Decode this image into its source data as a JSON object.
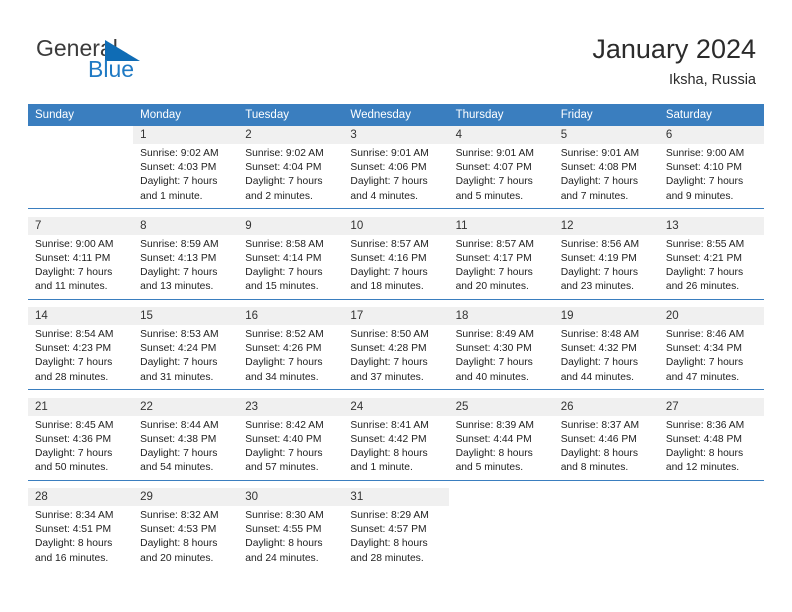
{
  "brand": {
    "name_top": "General",
    "name_bottom": "Blue",
    "logo_icon": "triangle-flag-icon",
    "color_top": "#3b3b3b",
    "color_bottom": "#1f7ac4",
    "triangle_color": "#0f6cb5"
  },
  "header": {
    "title": "January 2024",
    "subtitle": "Iksha, Russia"
  },
  "theme": {
    "header_bg": "#3a7ebf",
    "header_text": "#ffffff",
    "daynum_bg": "#f0f0f0",
    "week_rule": "#3a7ebf"
  },
  "weekday_headers": [
    "Sunday",
    "Monday",
    "Tuesday",
    "Wednesday",
    "Thursday",
    "Friday",
    "Saturday"
  ],
  "weeks": [
    [
      {
        "day": "",
        "sunrise": "",
        "sunset": "",
        "daylight_line1": "",
        "daylight_line2": ""
      },
      {
        "day": "1",
        "sunrise": "Sunrise: 9:02 AM",
        "sunset": "Sunset: 4:03 PM",
        "daylight_line1": "Daylight: 7 hours",
        "daylight_line2": "and 1 minute."
      },
      {
        "day": "2",
        "sunrise": "Sunrise: 9:02 AM",
        "sunset": "Sunset: 4:04 PM",
        "daylight_line1": "Daylight: 7 hours",
        "daylight_line2": "and 2 minutes."
      },
      {
        "day": "3",
        "sunrise": "Sunrise: 9:01 AM",
        "sunset": "Sunset: 4:06 PM",
        "daylight_line1": "Daylight: 7 hours",
        "daylight_line2": "and 4 minutes."
      },
      {
        "day": "4",
        "sunrise": "Sunrise: 9:01 AM",
        "sunset": "Sunset: 4:07 PM",
        "daylight_line1": "Daylight: 7 hours",
        "daylight_line2": "and 5 minutes."
      },
      {
        "day": "5",
        "sunrise": "Sunrise: 9:01 AM",
        "sunset": "Sunset: 4:08 PM",
        "daylight_line1": "Daylight: 7 hours",
        "daylight_line2": "and 7 minutes."
      },
      {
        "day": "6",
        "sunrise": "Sunrise: 9:00 AM",
        "sunset": "Sunset: 4:10 PM",
        "daylight_line1": "Daylight: 7 hours",
        "daylight_line2": "and 9 minutes."
      }
    ],
    [
      {
        "day": "7",
        "sunrise": "Sunrise: 9:00 AM",
        "sunset": "Sunset: 4:11 PM",
        "daylight_line1": "Daylight: 7 hours",
        "daylight_line2": "and 11 minutes."
      },
      {
        "day": "8",
        "sunrise": "Sunrise: 8:59 AM",
        "sunset": "Sunset: 4:13 PM",
        "daylight_line1": "Daylight: 7 hours",
        "daylight_line2": "and 13 minutes."
      },
      {
        "day": "9",
        "sunrise": "Sunrise: 8:58 AM",
        "sunset": "Sunset: 4:14 PM",
        "daylight_line1": "Daylight: 7 hours",
        "daylight_line2": "and 15 minutes."
      },
      {
        "day": "10",
        "sunrise": "Sunrise: 8:57 AM",
        "sunset": "Sunset: 4:16 PM",
        "daylight_line1": "Daylight: 7 hours",
        "daylight_line2": "and 18 minutes."
      },
      {
        "day": "11",
        "sunrise": "Sunrise: 8:57 AM",
        "sunset": "Sunset: 4:17 PM",
        "daylight_line1": "Daylight: 7 hours",
        "daylight_line2": "and 20 minutes."
      },
      {
        "day": "12",
        "sunrise": "Sunrise: 8:56 AM",
        "sunset": "Sunset: 4:19 PM",
        "daylight_line1": "Daylight: 7 hours",
        "daylight_line2": "and 23 minutes."
      },
      {
        "day": "13",
        "sunrise": "Sunrise: 8:55 AM",
        "sunset": "Sunset: 4:21 PM",
        "daylight_line1": "Daylight: 7 hours",
        "daylight_line2": "and 26 minutes."
      }
    ],
    [
      {
        "day": "14",
        "sunrise": "Sunrise: 8:54 AM",
        "sunset": "Sunset: 4:23 PM",
        "daylight_line1": "Daylight: 7 hours",
        "daylight_line2": "and 28 minutes."
      },
      {
        "day": "15",
        "sunrise": "Sunrise: 8:53 AM",
        "sunset": "Sunset: 4:24 PM",
        "daylight_line1": "Daylight: 7 hours",
        "daylight_line2": "and 31 minutes."
      },
      {
        "day": "16",
        "sunrise": "Sunrise: 8:52 AM",
        "sunset": "Sunset: 4:26 PM",
        "daylight_line1": "Daylight: 7 hours",
        "daylight_line2": "and 34 minutes."
      },
      {
        "day": "17",
        "sunrise": "Sunrise: 8:50 AM",
        "sunset": "Sunset: 4:28 PM",
        "daylight_line1": "Daylight: 7 hours",
        "daylight_line2": "and 37 minutes."
      },
      {
        "day": "18",
        "sunrise": "Sunrise: 8:49 AM",
        "sunset": "Sunset: 4:30 PM",
        "daylight_line1": "Daylight: 7 hours",
        "daylight_line2": "and 40 minutes."
      },
      {
        "day": "19",
        "sunrise": "Sunrise: 8:48 AM",
        "sunset": "Sunset: 4:32 PM",
        "daylight_line1": "Daylight: 7 hours",
        "daylight_line2": "and 44 minutes."
      },
      {
        "day": "20",
        "sunrise": "Sunrise: 8:46 AM",
        "sunset": "Sunset: 4:34 PM",
        "daylight_line1": "Daylight: 7 hours",
        "daylight_line2": "and 47 minutes."
      }
    ],
    [
      {
        "day": "21",
        "sunrise": "Sunrise: 8:45 AM",
        "sunset": "Sunset: 4:36 PM",
        "daylight_line1": "Daylight: 7 hours",
        "daylight_line2": "and 50 minutes."
      },
      {
        "day": "22",
        "sunrise": "Sunrise: 8:44 AM",
        "sunset": "Sunset: 4:38 PM",
        "daylight_line1": "Daylight: 7 hours",
        "daylight_line2": "and 54 minutes."
      },
      {
        "day": "23",
        "sunrise": "Sunrise: 8:42 AM",
        "sunset": "Sunset: 4:40 PM",
        "daylight_line1": "Daylight: 7 hours",
        "daylight_line2": "and 57 minutes."
      },
      {
        "day": "24",
        "sunrise": "Sunrise: 8:41 AM",
        "sunset": "Sunset: 4:42 PM",
        "daylight_line1": "Daylight: 8 hours",
        "daylight_line2": "and 1 minute."
      },
      {
        "day": "25",
        "sunrise": "Sunrise: 8:39 AM",
        "sunset": "Sunset: 4:44 PM",
        "daylight_line1": "Daylight: 8 hours",
        "daylight_line2": "and 5 minutes."
      },
      {
        "day": "26",
        "sunrise": "Sunrise: 8:37 AM",
        "sunset": "Sunset: 4:46 PM",
        "daylight_line1": "Daylight: 8 hours",
        "daylight_line2": "and 8 minutes."
      },
      {
        "day": "27",
        "sunrise": "Sunrise: 8:36 AM",
        "sunset": "Sunset: 4:48 PM",
        "daylight_line1": "Daylight: 8 hours",
        "daylight_line2": "and 12 minutes."
      }
    ],
    [
      {
        "day": "28",
        "sunrise": "Sunrise: 8:34 AM",
        "sunset": "Sunset: 4:51 PM",
        "daylight_line1": "Daylight: 8 hours",
        "daylight_line2": "and 16 minutes."
      },
      {
        "day": "29",
        "sunrise": "Sunrise: 8:32 AM",
        "sunset": "Sunset: 4:53 PM",
        "daylight_line1": "Daylight: 8 hours",
        "daylight_line2": "and 20 minutes."
      },
      {
        "day": "30",
        "sunrise": "Sunrise: 8:30 AM",
        "sunset": "Sunset: 4:55 PM",
        "daylight_line1": "Daylight: 8 hours",
        "daylight_line2": "and 24 minutes."
      },
      {
        "day": "31",
        "sunrise": "Sunrise: 8:29 AM",
        "sunset": "Sunset: 4:57 PM",
        "daylight_line1": "Daylight: 8 hours",
        "daylight_line2": "and 28 minutes."
      },
      {
        "day": "",
        "sunrise": "",
        "sunset": "",
        "daylight_line1": "",
        "daylight_line2": ""
      },
      {
        "day": "",
        "sunrise": "",
        "sunset": "",
        "daylight_line1": "",
        "daylight_line2": ""
      },
      {
        "day": "",
        "sunrise": "",
        "sunset": "",
        "daylight_line1": "",
        "daylight_line2": ""
      }
    ]
  ]
}
